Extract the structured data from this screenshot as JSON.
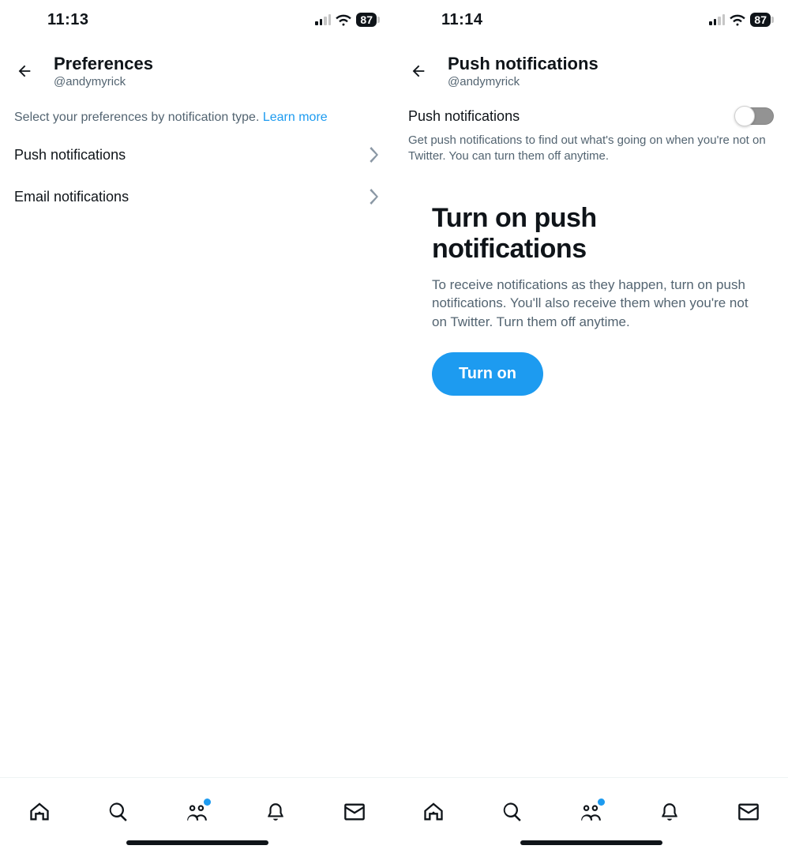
{
  "left": {
    "status": {
      "time": "11:13",
      "battery": "87"
    },
    "header": {
      "title": "Preferences",
      "handle": "@andymyrick"
    },
    "subhead_text": "Select your preferences by notification type. ",
    "subhead_link": "Learn more",
    "rows": {
      "push": "Push notifications",
      "email": "Email notifications"
    }
  },
  "right": {
    "status": {
      "time": "11:14",
      "battery": "87"
    },
    "header": {
      "title": "Push notifications",
      "handle": "@andymyrick"
    },
    "toggle_label": "Push notifications",
    "toggle_desc": "Get push notifications to find out what's going on when you're not on Twitter. You can turn them off anytime.",
    "promo": {
      "title": "Turn on push notifications",
      "body": "To receive notifications as they happen, turn on push notifications. You'll also receive them when you're not on Twitter. Turn them off anytime.",
      "button": "Turn on"
    }
  }
}
